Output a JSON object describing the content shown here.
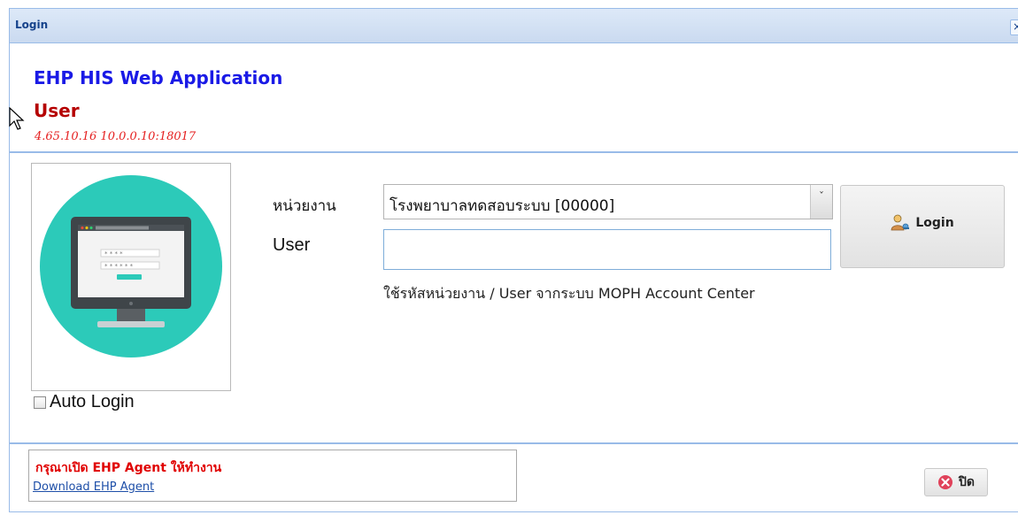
{
  "window": {
    "title": "Login",
    "close_glyph": "×"
  },
  "header": {
    "app_name": "EHP HIS Web Application",
    "user_title": "User",
    "version": "4.65.10.16 10.0.0.10:18017"
  },
  "form": {
    "unit_label": "หน่วยงาน",
    "unit_selected": "โรงพยาบาลทดสอบระบบ [00000]",
    "user_label": "User",
    "user_value": "",
    "hint": "ใช้รหัสหน่วยงาน / User จากระบบ MOPH Account Center",
    "auto_login_label": "Auto Login",
    "auto_login_checked": false,
    "login_button": "Login"
  },
  "footer": {
    "agent_message": "กรุณาเปิด EHP Agent ให้ทำงาน",
    "agent_link": "Download EHP Agent",
    "close_button": "ปิด"
  },
  "icons": {
    "login": "user-key-icon",
    "close": "red-x-circle-icon",
    "illustration": "monitor-login-illustration"
  },
  "colors": {
    "title_bar": "#cadaf0",
    "border": "#99bbe8",
    "app_name": "#1a1ae6",
    "user_title": "#b50000",
    "version": "#e52020",
    "agent_message": "#e00000",
    "illustration_circle": "#2ccab9"
  }
}
